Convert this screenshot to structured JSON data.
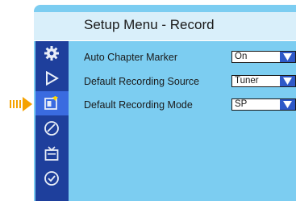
{
  "title": "Setup Menu - Record",
  "sidebar": {
    "items": [
      {
        "icon": "gear-icon"
      },
      {
        "icon": "play-icon"
      },
      {
        "icon": "record-icon",
        "selected": true
      },
      {
        "icon": "disc-icon"
      },
      {
        "icon": "tv-icon"
      },
      {
        "icon": "clock-icon"
      }
    ]
  },
  "settings": [
    {
      "label": "Auto Chapter Marker",
      "value": "On"
    },
    {
      "label": "Default Recording Source",
      "value": "Tuner"
    },
    {
      "label": "Default Recording Mode",
      "value": "SP"
    }
  ],
  "colors": {
    "background": "#7ccdf1",
    "title_bar": "#d9effa",
    "sidebar": "#1e3f9c",
    "selected": "#3a6be0",
    "pointer": "#f5a200"
  }
}
